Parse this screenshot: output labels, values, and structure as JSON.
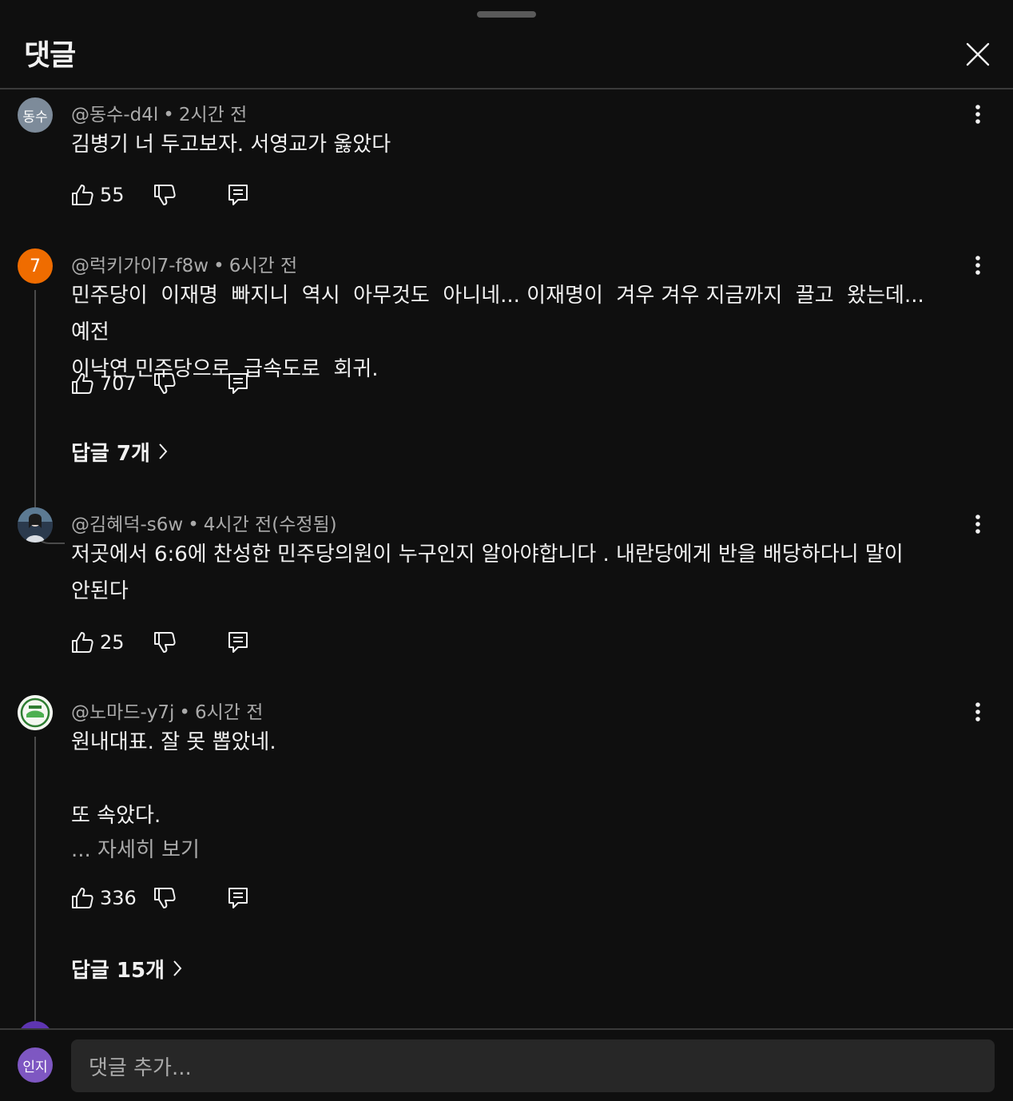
{
  "header": {
    "title": "댓글"
  },
  "comments": [
    {
      "author": "@동수-d4l",
      "time": "2시간 전",
      "avatar_text": "동수",
      "avatar_color": "#7d8b9a",
      "text": "김병기 너 두고보자. 서영교가 옳았다",
      "likes": "55"
    },
    {
      "author": "@럭키가이7-f8w",
      "time": "6시간 전",
      "avatar_text": "7",
      "avatar_color": "#ef6c00",
      "text": "민주당이  이재명  빠지니  역시  아무것도  아니네... 이재명이  겨우 겨우 지금까지  끌고  왔는데... 예전\n이낙연 민주당으로  급속도로  회귀.",
      "likes": "707",
      "replies": "답글 7개"
    },
    {
      "author": "@김혜덕-s6w",
      "time": "4시간 전(수정됨)",
      "avatar_text": "",
      "avatar_color": "#3b4a5c",
      "text": "저곳에서 6:6에 찬성한 민주당의원이 누구인지 알아야합니다 . 내란당에게 반을 배당하다니 말이\n안된다",
      "likes": "25"
    },
    {
      "author": "@노마드-y7j",
      "time": "6시간 전",
      "avatar_text": "",
      "avatar_color": "#e8efe6",
      "text": "원내대표. 잘 못 뽑았네.\n\n또 속았다.",
      "more": "... 자세히 보기",
      "likes": "336",
      "replies": "답글 15개"
    }
  ],
  "composer": {
    "avatar_text": "인지",
    "placeholder": "댓글 추가..."
  },
  "icons": {
    "close": "close-icon",
    "more": "more-vert-icon",
    "like": "thumb-up-icon",
    "dislike": "thumb-down-icon",
    "reply": "reply-icon",
    "chevron": "chevron-right-icon"
  }
}
